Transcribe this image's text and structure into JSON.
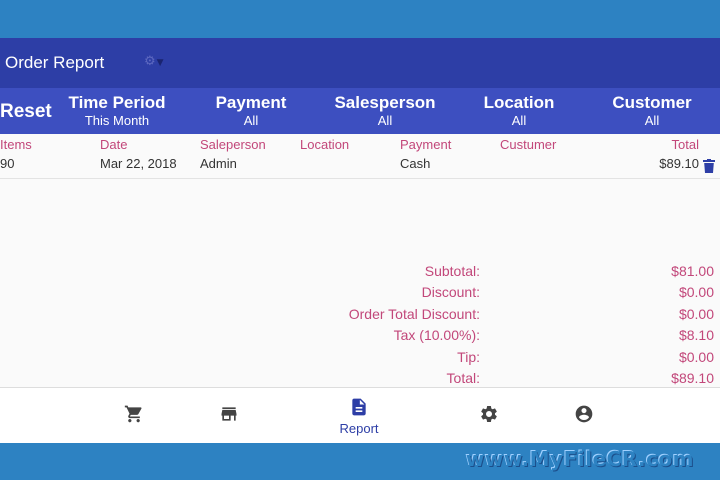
{
  "header": {
    "title": "Order Report",
    "dropdown_icon": "caret-down-icon"
  },
  "filters": {
    "reset_label": "Reset",
    "items": [
      {
        "label": "Time Period",
        "value": "This Month"
      },
      {
        "label": "Payment",
        "value": "All"
      },
      {
        "label": "Salesperson",
        "value": "All"
      },
      {
        "label": "Location",
        "value": "All"
      },
      {
        "label": "Customer",
        "value": "All"
      }
    ]
  },
  "table": {
    "columns": [
      "Items",
      "Date",
      "Saleperson",
      "Location",
      "Payment",
      "Custumer",
      "Total"
    ],
    "rows": [
      {
        "items": "90",
        "date": "Mar 22, 2018",
        "saleperson": "Admin",
        "location": "",
        "payment": "Cash",
        "customer": "",
        "total": "$89.10"
      }
    ],
    "delete_icon": "trash-icon"
  },
  "summary": [
    {
      "label": "Subtotal:",
      "value": "$81.00"
    },
    {
      "label": "Discount:",
      "value": "$0.00"
    },
    {
      "label": "Order Total Discount:",
      "value": "$0.00"
    },
    {
      "label": "Tax (10.00%):",
      "value": "$8.10"
    },
    {
      "label": "Tip:",
      "value": "$0.00"
    },
    {
      "label": "Total:",
      "value": "$89.10"
    }
  ],
  "nav": {
    "items": [
      {
        "icon": "cart-icon"
      },
      {
        "icon": "store-icon"
      },
      {
        "icon": "report-icon",
        "label": "Report",
        "active": true
      },
      {
        "icon": "gear-icon"
      },
      {
        "icon": "account-icon"
      }
    ]
  },
  "watermark": "www.MyFileCR.com",
  "colors": {
    "toolbar": "#2d3ea6",
    "filterbar": "#3d4fc0",
    "accent_text": "#c2477a",
    "frame": "#2d82c2"
  }
}
